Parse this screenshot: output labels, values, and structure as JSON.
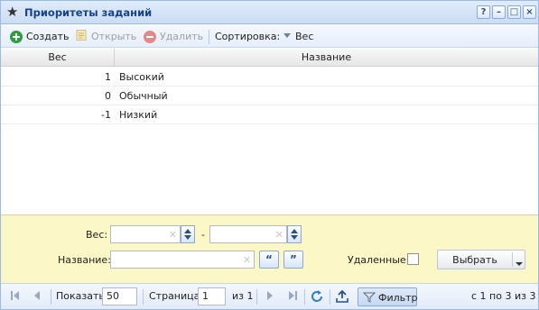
{
  "window": {
    "title": "Приоритеты заданий",
    "controls": [
      "?",
      "–",
      "□",
      "×"
    ]
  },
  "toolbar": {
    "create_label": "Создать",
    "open_label": "Открыть",
    "delete_label": "Удалить",
    "sort_label": "Сортировка:",
    "sort_field": "Вес"
  },
  "grid": {
    "columns": [
      "Вес",
      "Название"
    ],
    "rows": [
      {
        "weight": "1",
        "name": "Высокий"
      },
      {
        "weight": "0",
        "name": "Обычный"
      },
      {
        "weight": "-1",
        "name": "Низкий"
      }
    ]
  },
  "filter": {
    "weight_label": "Вес:",
    "range_dash": "-",
    "weight_from": "",
    "weight_to": "",
    "name_label": "Название:",
    "name_value": "",
    "quote_open": "“",
    "quote_close": "”",
    "deleted_label": "Удаленные:",
    "deleted_checked": false,
    "select_label": "Выбрать"
  },
  "pager": {
    "show_label": "Показать",
    "page_size": "50",
    "page_label": "Страница",
    "page_value": "1",
    "of_pages": "из 1",
    "filter_label": "Фильтр",
    "range_text": "с 1 по 3 из 3"
  },
  "colors": {
    "header_text": "#15428b",
    "filter_bg": "#fbf7c7",
    "create_icon": "#2e9d3e",
    "delete_icon": "#e28a8a"
  },
  "icons": {
    "title": "star-icon",
    "create": "add-circle-icon",
    "open": "open-document-icon",
    "delete": "remove-circle-icon",
    "sort": "sort-desc-icon",
    "filter": "funnel-icon",
    "refresh": "refresh-icon",
    "export": "export-icon"
  }
}
